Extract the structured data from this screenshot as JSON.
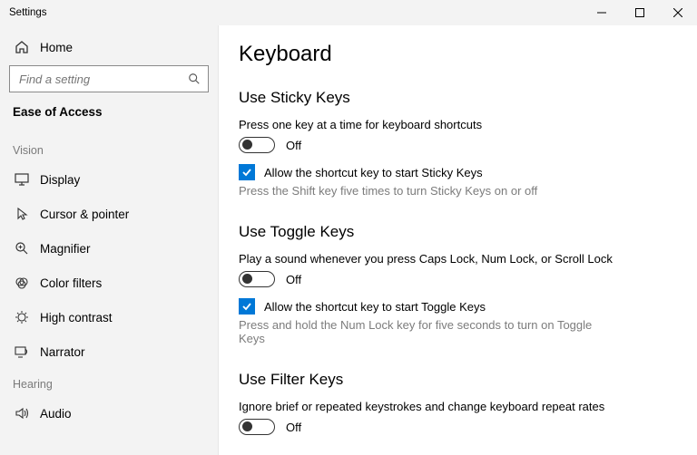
{
  "window": {
    "title": "Settings"
  },
  "sidebar": {
    "home": "Home",
    "search_placeholder": "Find a setting",
    "crumb": "Ease of Access",
    "groups": {
      "vision": "Vision",
      "hearing": "Hearing"
    },
    "items": {
      "display": "Display",
      "cursor": "Cursor & pointer",
      "magnifier": "Magnifier",
      "colorfilters": "Color filters",
      "highcontrast": "High contrast",
      "narrator": "Narrator",
      "audio": "Audio"
    }
  },
  "page": {
    "title": "Keyboard",
    "sticky": {
      "heading": "Use Sticky Keys",
      "desc": "Press one key at a time for keyboard shortcuts",
      "toggle_state": "Off",
      "check_label": "Allow the shortcut key to start Sticky Keys",
      "hint": "Press the Shift key five times to turn Sticky Keys on or off"
    },
    "togglekeys": {
      "heading": "Use Toggle Keys",
      "desc": "Play a sound whenever you press Caps Lock, Num Lock, or Scroll Lock",
      "toggle_state": "Off",
      "check_label": "Allow the shortcut key to start Toggle Keys",
      "hint": "Press and hold the Num Lock key for five seconds to turn on Toggle Keys"
    },
    "filter": {
      "heading": "Use Filter Keys",
      "desc": "Ignore brief or repeated keystrokes and change keyboard repeat rates",
      "toggle_state": "Off"
    }
  }
}
